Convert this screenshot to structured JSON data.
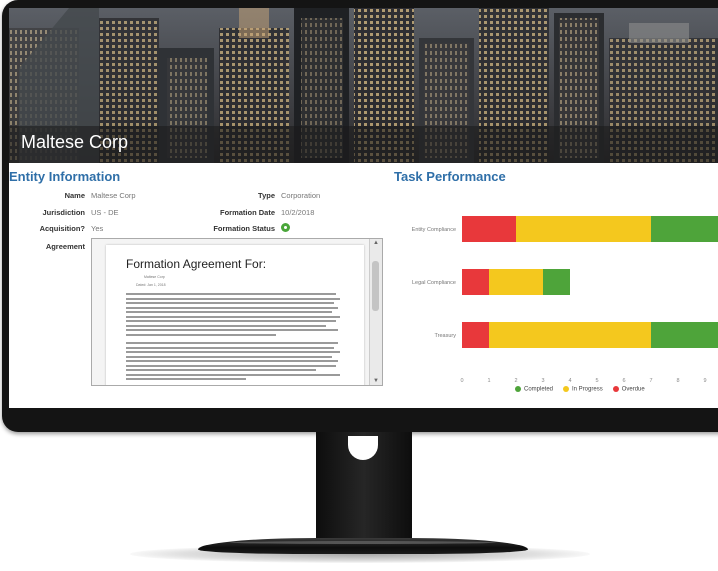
{
  "company_name": "Maltese Corp",
  "entity_info": {
    "title": "Entity Information",
    "name_label": "Name",
    "name_value": "Maltese Corp",
    "type_label": "Type",
    "type_value": "Corporation",
    "jurisdiction_label": "Jurisdiction",
    "jurisdiction_value": "US - DE",
    "formation_date_label": "Formation Date",
    "formation_date_value": "10/2/2018",
    "acquisition_label": "Acquisition?",
    "acquisition_value": "Yes",
    "formation_status_label": "Formation Status",
    "agreement_label": "Agreement"
  },
  "document": {
    "title": "Formation Agreement For:",
    "subtitle": "Maltese Corp",
    "date_line": "Dated: Jan 1, 2018"
  },
  "task_performance": {
    "title": "Task Performance"
  },
  "colors": {
    "completed": "#4ea43a",
    "in_progress": "#f4c81e",
    "overdue": "#e8383b",
    "title_blue": "#2f6fa8"
  },
  "chart_data": {
    "type": "bar",
    "orientation": "horizontal",
    "stacked": true,
    "categories": [
      "Entity Compliance",
      "Legal Compliance",
      "Treasury"
    ],
    "series": [
      {
        "name": "Overdue",
        "color": "#e8383b",
        "values": [
          2,
          1,
          1
        ]
      },
      {
        "name": "In Progress",
        "color": "#f4c81e",
        "values": [
          5,
          2,
          6
        ]
      },
      {
        "name": "Completed",
        "color": "#4ea43a",
        "values": [
          3,
          1,
          5
        ]
      }
    ],
    "xticks": [
      0,
      1,
      2,
      3,
      4,
      5,
      6,
      7,
      8,
      9,
      10
    ],
    "xlim": [
      0,
      10
    ],
    "legend": [
      {
        "label": "Completed",
        "color": "#4ea43a"
      },
      {
        "label": "In Progress",
        "color": "#f4c81e"
      },
      {
        "label": "Overdue",
        "color": "#e8383b"
      }
    ],
    "legend_position": "bottom",
    "grid": false
  }
}
